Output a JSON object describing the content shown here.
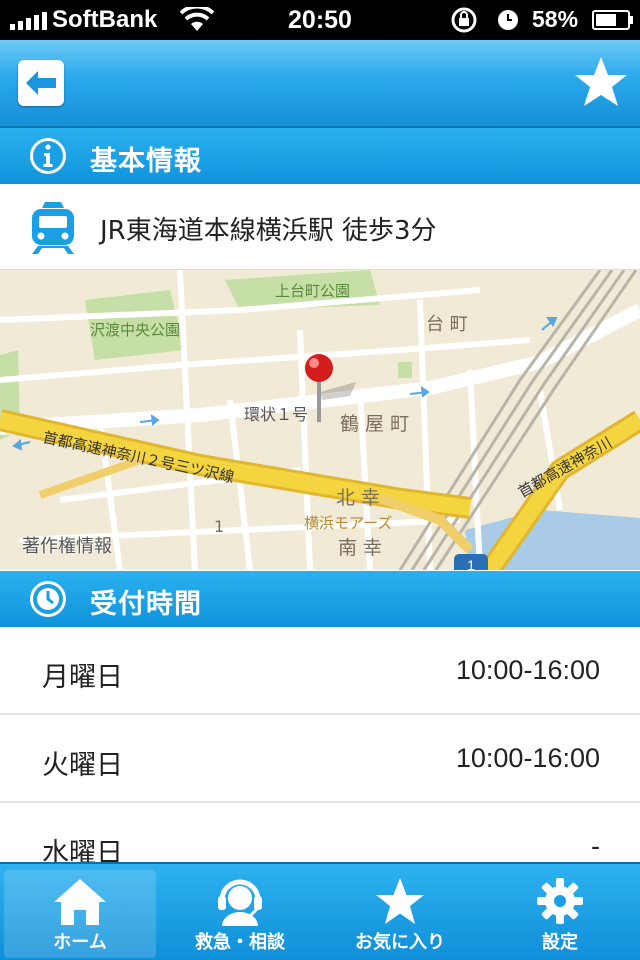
{
  "status_bar": {
    "carrier": "SoftBank",
    "time": "20:50",
    "battery": "58%"
  },
  "nav": {
    "back_icon": "back-arrow-icon",
    "favorite_icon": "star-icon"
  },
  "basic_info": {
    "title": "基本情報",
    "icon": "info-icon",
    "access_icon": "train-icon",
    "access": "JR東海道本線横浜駅 徒歩3分"
  },
  "map": {
    "labels": {
      "park1": "上台町公園",
      "park2": "沢渡中央公園",
      "district1": "台 町",
      "road_ring": "環状１号",
      "district2": "鶴 屋 町",
      "expressway": "首都高速神奈川２号三ツ沢線",
      "district3": "北 幸",
      "landmark": "横浜モアーズ",
      "district4": "南 幸",
      "expressway2": "首都高速神奈川",
      "route_num": "1",
      "route_shield": "1"
    },
    "credit": "著作権情報"
  },
  "reception": {
    "title": "受付時間",
    "icon": "clock-icon",
    "rows": [
      {
        "day": "月曜日",
        "hours": "10:00-16:00"
      },
      {
        "day": "火曜日",
        "hours": "10:00-16:00"
      },
      {
        "day": "水曜日",
        "hours": "-"
      }
    ]
  },
  "tabs": [
    {
      "label": "ホーム",
      "icon": "home-icon"
    },
    {
      "label": "救急・相談",
      "icon": "headset-icon"
    },
    {
      "label": "お気に入り",
      "icon": "star-icon"
    },
    {
      "label": "設定",
      "icon": "gear-icon"
    }
  ],
  "colors": {
    "accent": "#1a9fe4",
    "nav_dark": "#0d74b3"
  }
}
